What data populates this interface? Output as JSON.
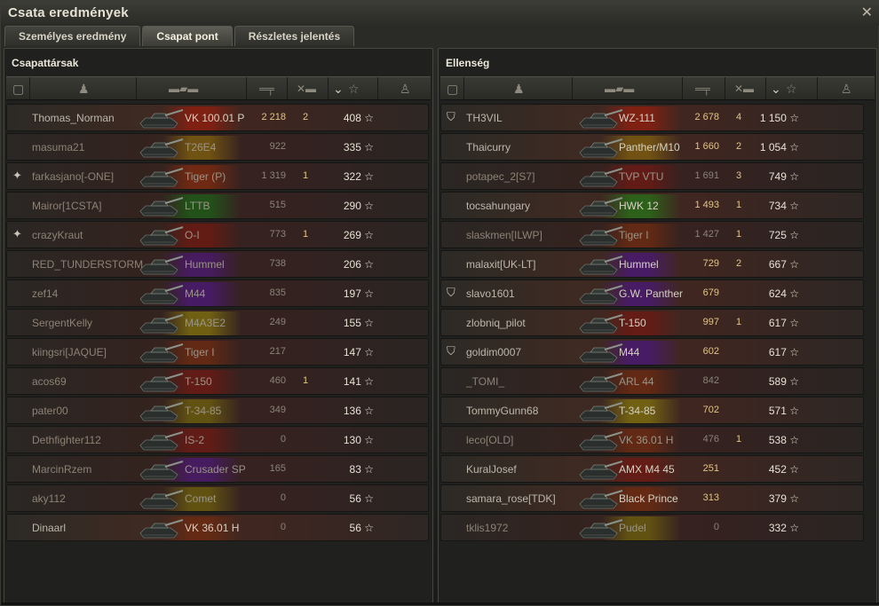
{
  "window": {
    "title": "Csata eredmények",
    "close_glyph": "✕"
  },
  "tabs": [
    {
      "label": "Személyes eredmény"
    },
    {
      "label": "Csapat pont"
    },
    {
      "label": "Részletes jelentés"
    }
  ],
  "icons": {
    "platoon": "platoon-icon",
    "player": "player-icon",
    "tank": "tank-icon",
    "damage": "damage-icon",
    "kills": "kills-icon",
    "points": "star-icon",
    "medal": "medal-icon"
  },
  "left": {
    "title": "Csapattársak",
    "rows": [
      {
        "name": "Thomas_Norman",
        "vehicle": "VK 100.01 P",
        "damage": "2 218",
        "kills": "2",
        "points": "408 ☆",
        "veh_color": "#8a1f10",
        "dead": false,
        "icon": ""
      },
      {
        "name": "masuma21",
        "vehicle": "T26E4",
        "damage": "922",
        "kills": "",
        "points": "335 ☆",
        "veh_color": "#7a5a10",
        "dead": true,
        "icon": ""
      },
      {
        "name": "farkasjano[-ONE]",
        "vehicle": "Tiger (P)",
        "damage": "1 319",
        "kills": "1",
        "points": "322 ☆",
        "veh_color": "#7a2a10",
        "dead": true,
        "icon": "clan-emblem-icon"
      },
      {
        "name": "Mairor[1CSTA]",
        "vehicle": "LTTB",
        "damage": "515",
        "kills": "",
        "points": "290 ☆",
        "veh_color": "#1f5a18",
        "dead": true,
        "icon": ""
      },
      {
        "name": "crazyKraut",
        "vehicle": "O-I",
        "damage": "773",
        "kills": "1",
        "points": "269 ☆",
        "veh_color": "#6a1a12",
        "dead": true,
        "icon": "clan-emblem-icon"
      },
      {
        "name": "RED_TUNDERSTORM",
        "vehicle": "Hummel",
        "damage": "738",
        "kills": "",
        "points": "206 ☆",
        "veh_color": "#4a1a6a",
        "dead": true,
        "icon": ""
      },
      {
        "name": "zef14",
        "vehicle": "M44",
        "damage": "835",
        "kills": "",
        "points": "197 ☆",
        "veh_color": "#4a1a70",
        "dead": true,
        "icon": ""
      },
      {
        "name": "SergentKelly",
        "vehicle": "M4A3E2",
        "damage": "249",
        "kills": "",
        "points": "155 ☆",
        "veh_color": "#7a6a10",
        "dead": true,
        "icon": ""
      },
      {
        "name": "kiingsri[JAQUE]",
        "vehicle": "Tiger I",
        "damage": "217",
        "kills": "",
        "points": "147 ☆",
        "veh_color": "#6a2a12",
        "dead": true,
        "icon": ""
      },
      {
        "name": "acos69",
        "vehicle": "T-150",
        "damage": "460",
        "kills": "1",
        "points": "141 ☆",
        "veh_color": "#6a1a14",
        "dead": true,
        "icon": ""
      },
      {
        "name": "pater00",
        "vehicle": "T-34-85",
        "damage": "349",
        "kills": "",
        "points": "136 ☆",
        "veh_color": "#6a5a10",
        "dead": true,
        "icon": ""
      },
      {
        "name": "Dethfighter112",
        "vehicle": "IS-2",
        "damage": "0",
        "kills": "",
        "points": "130 ☆",
        "veh_color": "#6a1a14",
        "dead": true,
        "icon": ""
      },
      {
        "name": "MarcinRzem",
        "vehicle": "Crusader SP",
        "damage": "165",
        "kills": "",
        "points": "83 ☆",
        "veh_color": "#4a1a6a",
        "dead": true,
        "icon": ""
      },
      {
        "name": "aky112",
        "vehicle": "Comet",
        "damage": "0",
        "kills": "",
        "points": "56 ☆",
        "veh_color": "#6a5a10",
        "dead": true,
        "icon": ""
      },
      {
        "name": "Dinaarl",
        "vehicle": "VK 36.01 H",
        "damage": "0",
        "kills": "",
        "points": "56 ☆",
        "veh_color": "#6a2a12",
        "dead": false,
        "icon": ""
      }
    ]
  },
  "right": {
    "title": "Ellenség",
    "rows": [
      {
        "name": "TH3VIL",
        "vehicle": "WZ-111",
        "damage": "2 678",
        "kills": "4",
        "points": "1 150 ☆",
        "veh_color": "#8a1f10",
        "dead": false,
        "icon": "platoon-icon"
      },
      {
        "name": "Thaicurry",
        "vehicle": "Panther/M10",
        "damage": "1 660",
        "kills": "2",
        "points": "1 054 ☆",
        "veh_color": "#7a5a10",
        "dead": false,
        "icon": ""
      },
      {
        "name": "potapec_2[S7]",
        "vehicle": "TVP VTU",
        "damage": "1 691",
        "kills": "3",
        "points": "749 ☆",
        "veh_color": "#6a1a14",
        "dead": true,
        "icon": ""
      },
      {
        "name": "tocsahungary",
        "vehicle": "HWK 12",
        "damage": "1 493",
        "kills": "1",
        "points": "734 ☆",
        "veh_color": "#2a6a18",
        "dead": false,
        "icon": ""
      },
      {
        "name": "slaskmen[ILWP]",
        "vehicle": "Tiger I",
        "damage": "1 427",
        "kills": "1",
        "points": "725 ☆",
        "veh_color": "#6a2a12",
        "dead": true,
        "icon": ""
      },
      {
        "name": "malaxit[UK-LT]",
        "vehicle": "Hummel",
        "damage": "729",
        "kills": "2",
        "points": "667 ☆",
        "veh_color": "#4a1a70",
        "dead": false,
        "icon": ""
      },
      {
        "name": "slavo1601",
        "vehicle": "G.W. Panther",
        "damage": "679",
        "kills": "",
        "points": "624 ☆",
        "veh_color": "#4a1a70",
        "dead": false,
        "icon": "platoon-icon"
      },
      {
        "name": "zlobniq_pilot",
        "vehicle": "T-150",
        "damage": "997",
        "kills": "1",
        "points": "617 ☆",
        "veh_color": "#6a1a14",
        "dead": false,
        "icon": ""
      },
      {
        "name": "goldim0007",
        "vehicle": "M44",
        "damage": "602",
        "kills": "",
        "points": "617 ☆",
        "veh_color": "#4a1a70",
        "dead": false,
        "icon": "platoon-icon"
      },
      {
        "name": "_TOMI_",
        "vehicle": "ARL 44",
        "damage": "842",
        "kills": "",
        "points": "589 ☆",
        "veh_color": "#6a2a12",
        "dead": true,
        "icon": ""
      },
      {
        "name": "TommyGunn68",
        "vehicle": "T-34-85",
        "damage": "702",
        "kills": "",
        "points": "571 ☆",
        "veh_color": "#7a6a10",
        "dead": false,
        "icon": ""
      },
      {
        "name": "leco[OLD]",
        "vehicle": "VK 36.01 H",
        "damage": "476",
        "kills": "1",
        "points": "538 ☆",
        "veh_color": "#6a2a12",
        "dead": true,
        "icon": ""
      },
      {
        "name": "KuralJosef",
        "vehicle": "AMX M4 45",
        "damage": "251",
        "kills": "",
        "points": "452 ☆",
        "veh_color": "#6a1a14",
        "dead": false,
        "icon": ""
      },
      {
        "name": "samara_rose[TDK]",
        "vehicle": "Black Prince",
        "damage": "313",
        "kills": "",
        "points": "379 ☆",
        "veh_color": "#6a2a12",
        "dead": false,
        "icon": ""
      },
      {
        "name": "tklis1972",
        "vehicle": "Pudel",
        "damage": "0",
        "kills": "",
        "points": "332 ☆",
        "veh_color": "#6a5a10",
        "dead": true,
        "icon": ""
      }
    ]
  }
}
